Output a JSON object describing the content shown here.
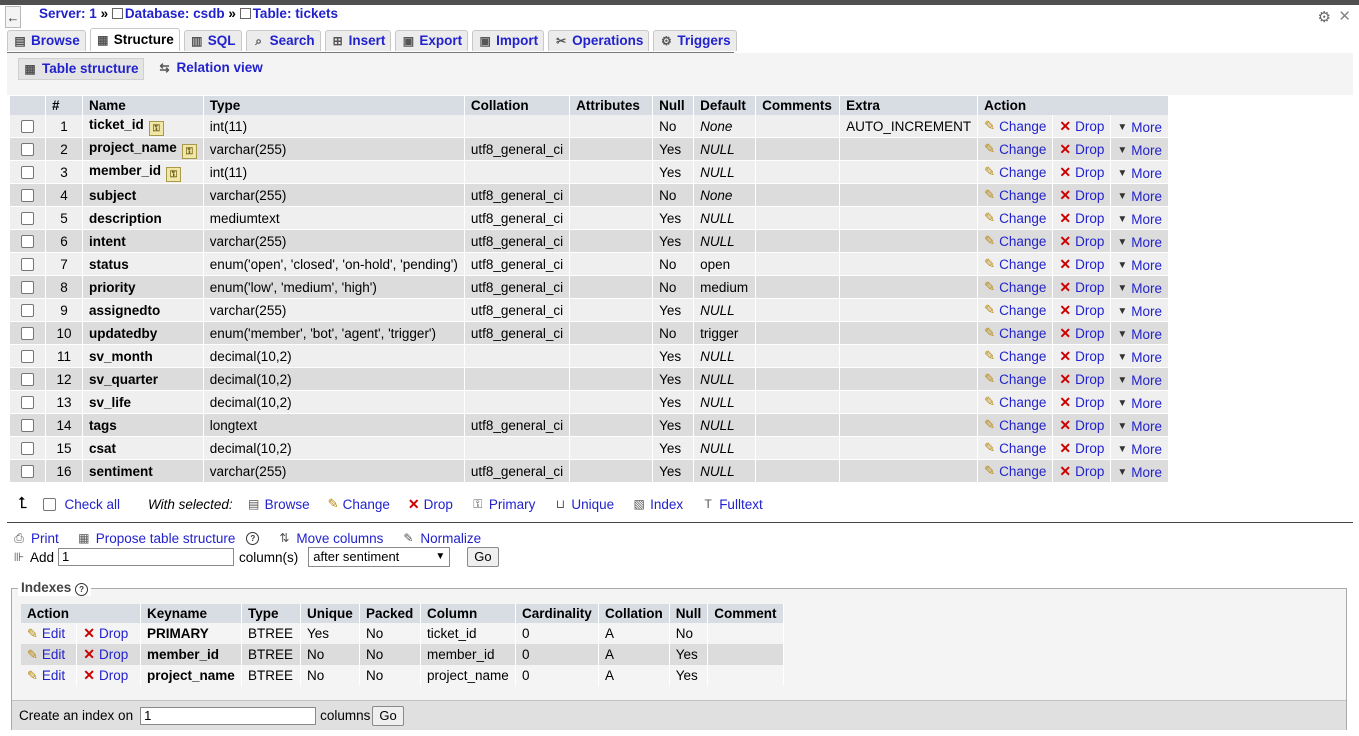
{
  "breadcrumb": {
    "server": "Server: 1",
    "sep1": "»",
    "database": "Database: csdb",
    "sep2": "»",
    "table": "Table: tickets"
  },
  "tabs": [
    {
      "label": "Browse",
      "icon": "browse-icon"
    },
    {
      "label": "Structure",
      "icon": "structure-icon",
      "active": true
    },
    {
      "label": "SQL",
      "icon": "sql-icon"
    },
    {
      "label": "Search",
      "icon": "search-icon"
    },
    {
      "label": "Insert",
      "icon": "insert-icon"
    },
    {
      "label": "Export",
      "icon": "export-icon"
    },
    {
      "label": "Import",
      "icon": "import-icon"
    },
    {
      "label": "Operations",
      "icon": "operations-icon"
    },
    {
      "label": "Triggers",
      "icon": "triggers-icon"
    }
  ],
  "subtabs": [
    {
      "label": "Table structure",
      "active": true
    },
    {
      "label": "Relation view"
    }
  ],
  "fields_table": {
    "headers": [
      "#",
      "Name",
      "Type",
      "Collation",
      "Attributes",
      "Null",
      "Default",
      "Comments",
      "Extra",
      "Action"
    ],
    "rows": [
      {
        "num": "1",
        "name": "ticket_id",
        "key": true,
        "type": "int(11)",
        "collation": "",
        "attributes": "",
        "null": "No",
        "default": "None",
        "default_italic": true,
        "comments": "",
        "extra": "AUTO_INCREMENT"
      },
      {
        "num": "2",
        "name": "project_name",
        "key": true,
        "type": "varchar(255)",
        "collation": "utf8_general_ci",
        "attributes": "",
        "null": "Yes",
        "default": "NULL",
        "default_italic": true,
        "comments": "",
        "extra": ""
      },
      {
        "num": "3",
        "name": "member_id",
        "key": true,
        "type": "int(11)",
        "collation": "",
        "attributes": "",
        "null": "Yes",
        "default": "NULL",
        "default_italic": true,
        "comments": "",
        "extra": ""
      },
      {
        "num": "4",
        "name": "subject",
        "key": false,
        "type": "varchar(255)",
        "collation": "utf8_general_ci",
        "attributes": "",
        "null": "No",
        "default": "None",
        "default_italic": true,
        "comments": "",
        "extra": ""
      },
      {
        "num": "5",
        "name": "description",
        "key": false,
        "type": "mediumtext",
        "collation": "utf8_general_ci",
        "attributes": "",
        "null": "Yes",
        "default": "NULL",
        "default_italic": true,
        "comments": "",
        "extra": ""
      },
      {
        "num": "6",
        "name": "intent",
        "key": false,
        "type": "varchar(255)",
        "collation": "utf8_general_ci",
        "attributes": "",
        "null": "Yes",
        "default": "NULL",
        "default_italic": true,
        "comments": "",
        "extra": ""
      },
      {
        "num": "7",
        "name": "status",
        "key": false,
        "type": "enum('open', 'closed', 'on-hold', 'pending')",
        "collation": "utf8_general_ci",
        "attributes": "",
        "null": "No",
        "default": "open",
        "default_italic": false,
        "comments": "",
        "extra": ""
      },
      {
        "num": "8",
        "name": "priority",
        "key": false,
        "type": "enum('low', 'medium', 'high')",
        "collation": "utf8_general_ci",
        "attributes": "",
        "null": "No",
        "default": "medium",
        "default_italic": false,
        "comments": "",
        "extra": ""
      },
      {
        "num": "9",
        "name": "assignedto",
        "key": false,
        "type": "varchar(255)",
        "collation": "utf8_general_ci",
        "attributes": "",
        "null": "Yes",
        "default": "NULL",
        "default_italic": true,
        "comments": "",
        "extra": ""
      },
      {
        "num": "10",
        "name": "updatedby",
        "key": false,
        "type": "enum('member', 'bot', 'agent', 'trigger')",
        "collation": "utf8_general_ci",
        "attributes": "",
        "null": "No",
        "default": "trigger",
        "default_italic": false,
        "comments": "",
        "extra": ""
      },
      {
        "num": "11",
        "name": "sv_month",
        "key": false,
        "type": "decimal(10,2)",
        "collation": "",
        "attributes": "",
        "null": "Yes",
        "default": "NULL",
        "default_italic": true,
        "comments": "",
        "extra": ""
      },
      {
        "num": "12",
        "name": "sv_quarter",
        "key": false,
        "type": "decimal(10,2)",
        "collation": "",
        "attributes": "",
        "null": "Yes",
        "default": "NULL",
        "default_italic": true,
        "comments": "",
        "extra": ""
      },
      {
        "num": "13",
        "name": "sv_life",
        "key": false,
        "type": "decimal(10,2)",
        "collation": "",
        "attributes": "",
        "null": "Yes",
        "default": "NULL",
        "default_italic": true,
        "comments": "",
        "extra": ""
      },
      {
        "num": "14",
        "name": "tags",
        "key": false,
        "type": "longtext",
        "collation": "utf8_general_ci",
        "attributes": "",
        "null": "Yes",
        "default": "NULL",
        "default_italic": true,
        "comments": "",
        "extra": ""
      },
      {
        "num": "15",
        "name": "csat",
        "key": false,
        "type": "decimal(10,2)",
        "collation": "",
        "attributes": "",
        "null": "Yes",
        "default": "NULL",
        "default_italic": true,
        "comments": "",
        "extra": ""
      },
      {
        "num": "16",
        "name": "sentiment",
        "key": false,
        "type": "varchar(255)",
        "collation": "utf8_general_ci",
        "attributes": "",
        "null": "Yes",
        "default": "NULL",
        "default_italic": true,
        "comments": "",
        "extra": ""
      }
    ],
    "action_labels": {
      "change": "Change",
      "drop": "Drop",
      "more": "More"
    }
  },
  "with_selected": {
    "check_all": "Check all",
    "label": "With selected:",
    "actions": [
      "Browse",
      "Change",
      "Drop",
      "Primary",
      "Unique",
      "Index",
      "Fulltext"
    ]
  },
  "tools": {
    "print": "Print",
    "propose": "Propose table structure",
    "move_columns": "Move columns",
    "normalize": "Normalize"
  },
  "add_column": {
    "label": "Add",
    "value": "1",
    "unit": "column(s)",
    "position": "after sentiment",
    "go": "Go"
  },
  "indexes": {
    "legend": "Indexes",
    "headers": [
      "Action",
      "Keyname",
      "Type",
      "Unique",
      "Packed",
      "Column",
      "Cardinality",
      "Collation",
      "Null",
      "Comment"
    ],
    "action_labels": {
      "edit": "Edit",
      "drop": "Drop"
    },
    "rows": [
      {
        "keyname": "PRIMARY",
        "type": "BTREE",
        "unique": "Yes",
        "packed": "No",
        "column": "ticket_id",
        "cardinality": "0",
        "collation": "A",
        "null": "No",
        "comment": ""
      },
      {
        "keyname": "member_id",
        "type": "BTREE",
        "unique": "No",
        "packed": "No",
        "column": "member_id",
        "cardinality": "0",
        "collation": "A",
        "null": "Yes",
        "comment": ""
      },
      {
        "keyname": "project_name",
        "type": "BTREE",
        "unique": "No",
        "packed": "No",
        "column": "project_name",
        "cardinality": "0",
        "collation": "A",
        "null": "Yes",
        "comment": ""
      }
    ],
    "create_label": "Create an index on",
    "create_value": "1",
    "create_unit": "columns",
    "create_go": "Go"
  }
}
